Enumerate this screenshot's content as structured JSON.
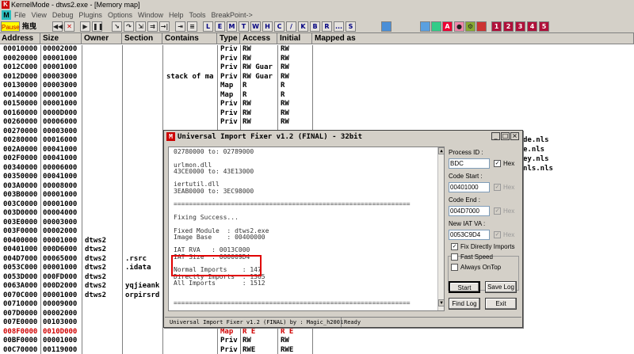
{
  "titlebar": {
    "title": "KernelMode - dtws2.exe - [Memory map]"
  },
  "menubar": {
    "items": [
      "File",
      "View",
      "Debug",
      "Plugins",
      "Options",
      "Window",
      "Help",
      "Tools",
      "BreakPoint->"
    ]
  },
  "toolbar": {
    "pause": "Pause",
    "cn_label": "拖曳",
    "letters": [
      "L",
      "E",
      "M",
      "T",
      "W",
      "H",
      "C",
      "/",
      "K",
      "B",
      "R",
      "...",
      "S"
    ],
    "numbers": [
      "1",
      "2",
      "3",
      "4",
      "5"
    ]
  },
  "columns": [
    "Address",
    "Size",
    "Owner",
    "Section",
    "Contains",
    "Type",
    "Access",
    "Initial",
    "Mapped as"
  ],
  "memrows": [
    {
      "addr": "00010000",
      "size": "00002000",
      "owner": "",
      "section": "",
      "contains": "",
      "type": "Priv",
      "access": "RW",
      "initial": "RW"
    },
    {
      "addr": "00020000",
      "size": "00001000",
      "owner": "",
      "section": "",
      "contains": "",
      "type": "Priv",
      "access": "RW",
      "initial": "RW"
    },
    {
      "addr": "0012C000",
      "size": "00001000",
      "owner": "",
      "section": "",
      "contains": "",
      "type": "Priv",
      "access": "RW  Guar",
      "initial": "RW"
    },
    {
      "addr": "0012D000",
      "size": "00003000",
      "owner": "",
      "section": "",
      "contains": "stack of ma",
      "type": "Priv",
      "access": "RW  Guar",
      "initial": "RW"
    },
    {
      "addr": "00130000",
      "size": "00003000",
      "owner": "",
      "section": "",
      "contains": "",
      "type": "Map",
      "access": "R",
      "initial": "R"
    },
    {
      "addr": "00140000",
      "size": "00001000",
      "owner": "",
      "section": "",
      "contains": "",
      "type": "Map",
      "access": "R",
      "initial": "R"
    },
    {
      "addr": "00150000",
      "size": "00001000",
      "owner": "",
      "section": "",
      "contains": "",
      "type": "Priv",
      "access": "RW",
      "initial": "RW"
    },
    {
      "addr": "00160000",
      "size": "0000D000",
      "owner": "",
      "section": "",
      "contains": "",
      "type": "Priv",
      "access": "RW",
      "initial": "RW"
    },
    {
      "addr": "00260000",
      "size": "00006000",
      "owner": "",
      "section": "",
      "contains": "",
      "type": "Priv",
      "access": "RW",
      "initial": "RW"
    },
    {
      "addr": "00270000",
      "size": "00003000",
      "owner": "",
      "section": "",
      "contains": "",
      "type": "",
      "access": "",
      "initial": ""
    },
    {
      "addr": "00280000",
      "size": "00016000",
      "owner": "",
      "section": "",
      "contains": "",
      "type": "",
      "access": "",
      "initial": ""
    },
    {
      "addr": "002A0000",
      "size": "00041000",
      "owner": "",
      "section": "",
      "contains": "",
      "type": "",
      "access": "",
      "initial": ""
    },
    {
      "addr": "002F0000",
      "size": "00041000",
      "owner": "",
      "section": "",
      "contains": "",
      "type": "",
      "access": "",
      "initial": ""
    },
    {
      "addr": "00340000",
      "size": "00006000",
      "owner": "",
      "section": "",
      "contains": "",
      "type": "",
      "access": "",
      "initial": ""
    },
    {
      "addr": "00350000",
      "size": "00041000",
      "owner": "",
      "section": "",
      "contains": "",
      "type": "",
      "access": "",
      "initial": ""
    },
    {
      "addr": "003A0000",
      "size": "00008000",
      "owner": "",
      "section": "",
      "contains": "",
      "type": "",
      "access": "",
      "initial": ""
    },
    {
      "addr": "003B0000",
      "size": "00001000",
      "owner": "",
      "section": "",
      "contains": "",
      "type": "",
      "access": "",
      "initial": ""
    },
    {
      "addr": "003C0000",
      "size": "00001000",
      "owner": "",
      "section": "",
      "contains": "",
      "type": "",
      "access": "",
      "initial": ""
    },
    {
      "addr": "003D0000",
      "size": "00004000",
      "owner": "",
      "section": "",
      "contains": "",
      "type": "",
      "access": "",
      "initial": ""
    },
    {
      "addr": "003E0000",
      "size": "00003000",
      "owner": "",
      "section": "",
      "contains": "",
      "type": "",
      "access": "",
      "initial": ""
    },
    {
      "addr": "003F0000",
      "size": "00002000",
      "owner": "",
      "section": "",
      "contains": "",
      "type": "",
      "access": "",
      "initial": ""
    },
    {
      "addr": "00400000",
      "size": "00001000",
      "owner": "dtws2",
      "section": "",
      "contains": "",
      "type": "",
      "access": "",
      "initial": ""
    },
    {
      "addr": "00401000",
      "size": "000D6000",
      "owner": "dtws2",
      "section": "",
      "contains": "",
      "type": "",
      "access": "",
      "initial": ""
    },
    {
      "addr": "004D7000",
      "size": "00065000",
      "owner": "dtws2",
      "section": ".rsrc",
      "contains": "",
      "type": "",
      "access": "",
      "initial": ""
    },
    {
      "addr": "0053C000",
      "size": "00001000",
      "owner": "dtws2",
      "section": ".idata",
      "contains": "",
      "type": "",
      "access": "",
      "initial": ""
    },
    {
      "addr": "0053D000",
      "size": "000FD000",
      "owner": "dtws2",
      "section": "",
      "contains": "",
      "type": "",
      "access": "",
      "initial": ""
    },
    {
      "addr": "0063A000",
      "size": "000D2000",
      "owner": "dtws2",
      "section": "yqjieank",
      "contains": "",
      "type": "",
      "access": "",
      "initial": ""
    },
    {
      "addr": "0070C000",
      "size": "00001000",
      "owner": "dtws2",
      "section": "orpirsrd",
      "contains": "",
      "type": "",
      "access": "",
      "initial": ""
    },
    {
      "addr": "00710000",
      "size": "00009000",
      "owner": "",
      "section": "",
      "contains": "",
      "type": "",
      "access": "",
      "initial": ""
    },
    {
      "addr": "007D0000",
      "size": "00002000",
      "owner": "",
      "section": "",
      "contains": "",
      "type": "",
      "access": "",
      "initial": ""
    },
    {
      "addr": "007E0000",
      "size": "00103000",
      "owner": "",
      "section": "",
      "contains": "",
      "type": "",
      "access": "",
      "initial": ""
    },
    {
      "addr": "008F0000",
      "size": "0010D000",
      "owner": "",
      "section": "",
      "contains": "",
      "type": "Map",
      "access": "R E",
      "initial": "R E",
      "red": true
    },
    {
      "addr": "00BF0000",
      "size": "00001000",
      "owner": "",
      "section": "",
      "contains": "",
      "type": "Priv",
      "access": "RW",
      "initial": "RW"
    },
    {
      "addr": "00C70000",
      "size": "00119000",
      "owner": "",
      "section": "",
      "contains": "",
      "type": "Priv",
      "access": "RWE",
      "initial": "RWE"
    }
  ],
  "right_names": [
    "de.nls",
    "e.nls",
    "ey.nls",
    "nls.nls"
  ],
  "dialog": {
    "title": "Universal Import Fixer v1.2  (FINAL)   -  32bit",
    "log": [
      "02780000 to: 02789000",
      "",
      "urlmon.dll",
      "43CE0000 to: 43E13000",
      "",
      "iertutil.dll",
      "3EAB0000 to: 3EC98000",
      "",
      "==============================================================",
      "",
      "Fixing Success...",
      "",
      "Fixed Module  : dtws2.exe",
      "Image Base    : 00400000",
      "",
      "IAT RVA   : 0013C000",
      "IAT Size  : 000009D4",
      "",
      "Normal Imports    : 147",
      "Directly Imports  : 1365",
      "All Imports       : 1512",
      "",
      "",
      "=============================================================="
    ],
    "process_id": {
      "label": "Process ID :",
      "value": "BDC",
      "hex": "Hex"
    },
    "code_start": {
      "label": "Code Start :",
      "value": "00401000",
      "hex": "Hex"
    },
    "code_end": {
      "label": "Code End :",
      "value": "004D7000",
      "hex": "Hex"
    },
    "new_iat": {
      "label": "New IAT VA :",
      "value": "0053C9D4",
      "hex": "Hex"
    },
    "options": {
      "fix_directly": "Fix Directly Imports",
      "fast_speed": "Fast Speed",
      "always_on_top": "Always OnTop"
    },
    "buttons": {
      "start": "Start",
      "save_log": "Save Log",
      "find_log": "Find Log",
      "exit": "Exit"
    },
    "status_left": "Universal Import Fixer v1.2  (FINAL)  by : Magic_h2001",
    "status_right": "Ready"
  }
}
